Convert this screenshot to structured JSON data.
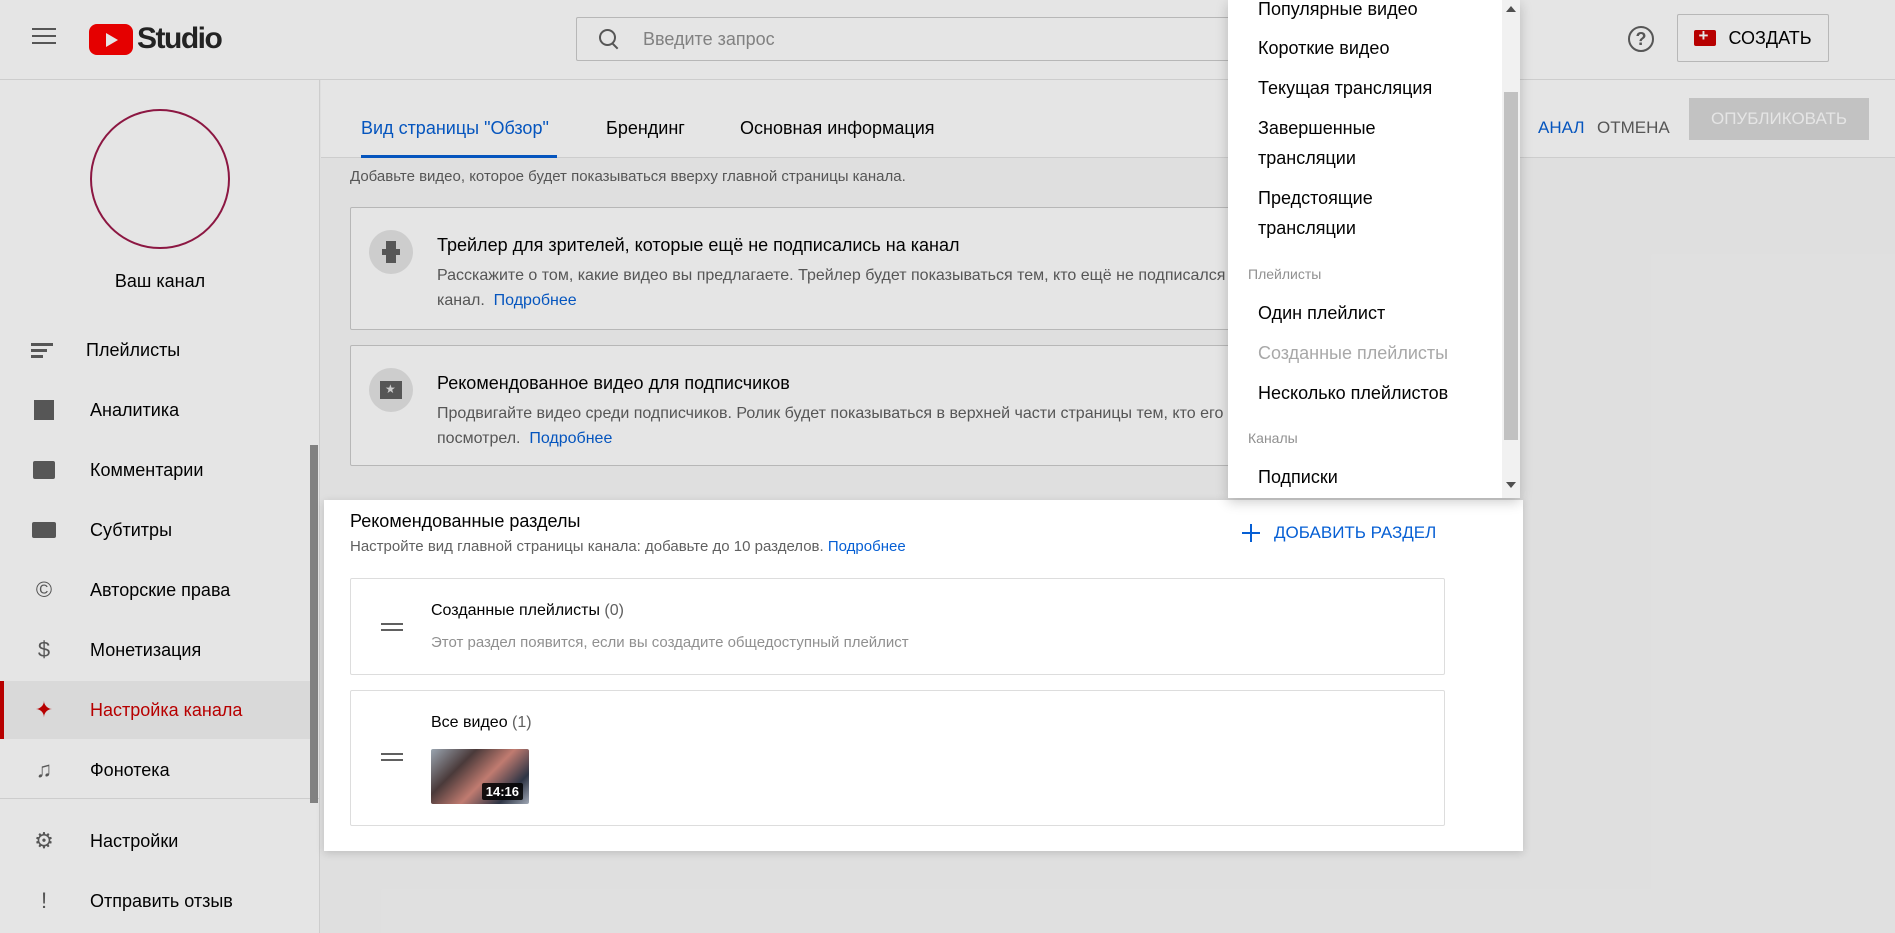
{
  "header": {
    "logo_text": "Studio",
    "search_placeholder": "Введите запрос",
    "create_label": "СОЗДАТЬ"
  },
  "sidebar": {
    "channel_name": "Ваш канал",
    "items": [
      {
        "label": "Плейлисты",
        "icon": "playlist-icon"
      },
      {
        "label": "Аналитика",
        "icon": "analytics-icon"
      },
      {
        "label": "Комментарии",
        "icon": "comments-icon"
      },
      {
        "label": "Субтитры",
        "icon": "subtitles-icon"
      },
      {
        "label": "Авторские права",
        "icon": "copyright-icon"
      },
      {
        "label": "Монетизация",
        "icon": "dollar-icon"
      },
      {
        "label": "Настройка канала",
        "icon": "magic-wand-icon",
        "active": true
      },
      {
        "label": "Фонотека",
        "icon": "audio-library-icon"
      },
      {
        "label": "Настройки",
        "icon": "gear-icon"
      },
      {
        "label": "Отправить отзыв",
        "icon": "feedback-icon"
      }
    ]
  },
  "tabs": {
    "items": [
      "Вид страницы \"Обзор\"",
      "Брендинг",
      "Основная информация"
    ],
    "active_index": 0,
    "view_channel": "АНАЛ",
    "cancel": "ОТМЕНА",
    "publish": "ОПУБЛИКОВАТЬ"
  },
  "main": {
    "intro": "Добавьте видео, которое будет показываться вверху главной страницы канала.",
    "more_link": "Подробнее",
    "cards": [
      {
        "title": "Трейлер для зрителей, которые ещё не подписались на канал",
        "desc_line1": "Расскажите о том, какие видео вы предлагаете. Трейлер будет показываться тем, кто ещё не подписался на",
        "desc_line2": "канал."
      },
      {
        "title": "Рекомендованное видео для подписчиков",
        "desc_line1": "Продвигайте видео среди подписчиков. Ролик будет показываться в верхней части страницы тем, кто его ещё не",
        "desc_line2": "посмотрел."
      }
    ]
  },
  "sections": {
    "title": "Рекомендованные разделы",
    "desc": "Настройте вид главной страницы канала: добавьте до 10 разделов.",
    "more_link": "Подробнее",
    "add_label": "ДОБАВИТЬ РАЗДЕЛ",
    "rows": [
      {
        "name": "Созданные плейлисты",
        "count": "(0)",
        "hint": "Этот раздел появится, если вы создадите общедоступный плейлист"
      },
      {
        "name": "Все видео",
        "count": "(1)",
        "thumb_duration": "14:16"
      }
    ]
  },
  "dropdown": {
    "items_top": [
      "Популярные видео",
      "Короткие видео",
      "Текущая трансляция"
    ],
    "finished_line1": "Завершенные",
    "finished_line2": "трансляции",
    "upcoming_line1": "Предстоящие",
    "upcoming_line2": "трансляции",
    "group_playlists": "Плейлисты",
    "single_playlist": "Один плейлист",
    "created_playlists": "Созданные плейлисты",
    "multiple_playlists": "Несколько плейлистов",
    "group_channels": "Каналы",
    "subscriptions": "Подписки"
  },
  "colors": {
    "accent": "#065fd4",
    "brand_red": "#ff0000",
    "active_red": "#cc0000"
  }
}
